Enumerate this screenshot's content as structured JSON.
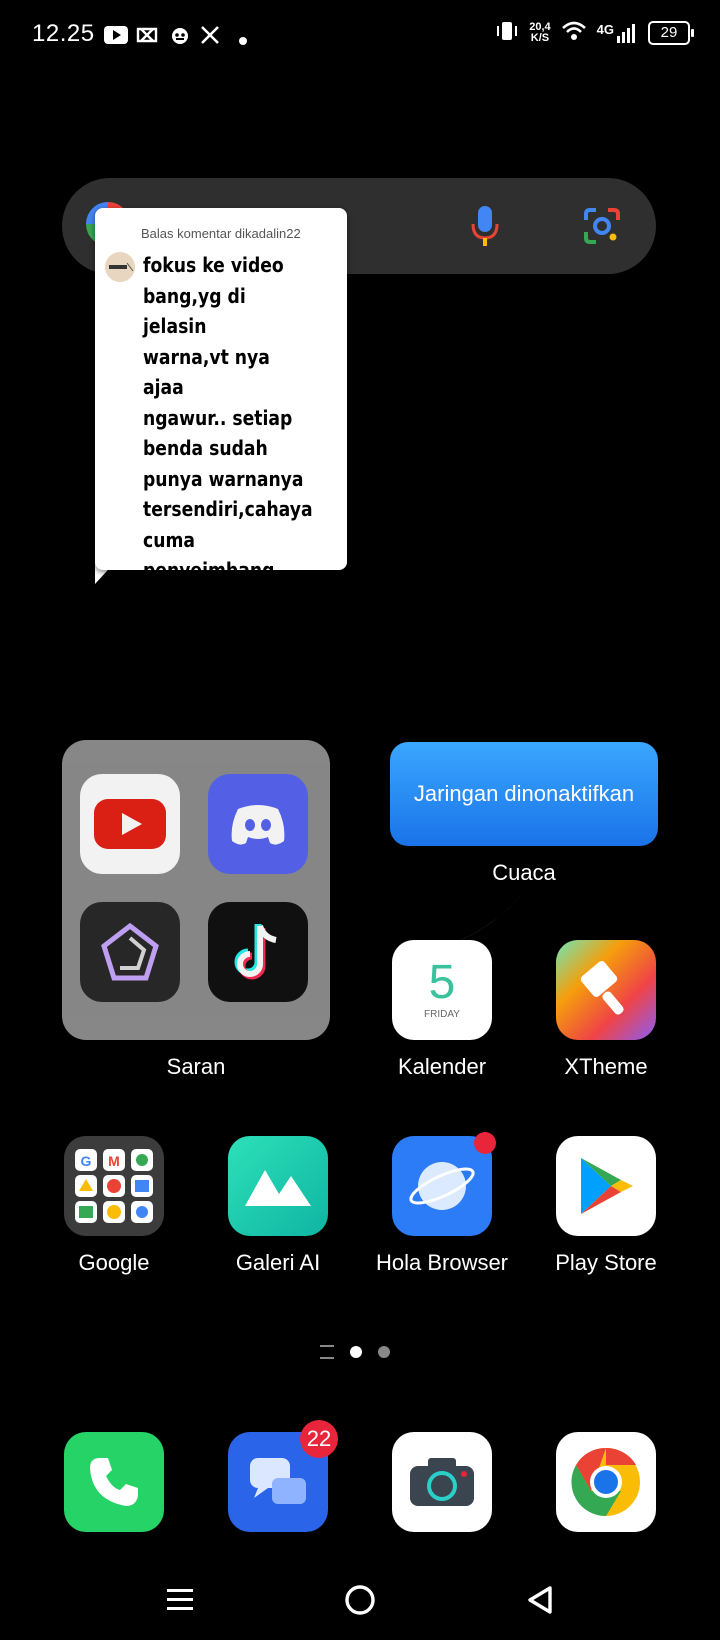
{
  "status_bar": {
    "time": "12.25",
    "net_speed_value": "20,4",
    "net_speed_unit": "K/S",
    "network": "4G",
    "battery": "29"
  },
  "search_bar": {},
  "comment_card": {
    "header": "Balas komentar dikadalin22",
    "text": "fokus ke video\nbang,yg di jelasin\nwarna,vt nya ajaa\nngawur.. setiap\nbenda sudah\npunya warnanya\ntersendiri,cahaya\ncuma penyeimbang\nterang dan gelap\ndoang"
  },
  "folder": {
    "label": "Saran",
    "apps": [
      "youtube",
      "discord",
      "pentagon-app",
      "tiktok"
    ]
  },
  "weather_widget": {
    "button_text": "Jaringan dinonaktifkan",
    "label": "Cuaca"
  },
  "calendar": {
    "day_number": "5",
    "day_name": "FRIDAY",
    "label": "Kalender"
  },
  "row1_apps": [
    {
      "label": "XTheme"
    }
  ],
  "row2_apps": [
    {
      "label": "Google"
    },
    {
      "label": "Galeri AI"
    },
    {
      "label": "Hola Browser"
    },
    {
      "label": "Play Store"
    }
  ],
  "dock": {
    "messages_badge": "22"
  },
  "colors": {
    "accent_blue": "#1a73e8",
    "badge_red": "#e8253a"
  }
}
